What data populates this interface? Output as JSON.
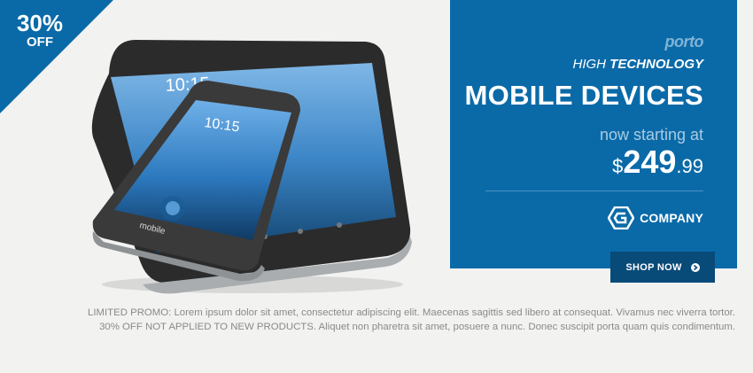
{
  "badge": {
    "percent": "30%",
    "off": "OFF"
  },
  "panel": {
    "brand": "porto",
    "subtitle_light": "HIGH",
    "subtitle_bold": "TECHNOLOGY",
    "headline": "MOBILE DEVICES",
    "starting_text": "now starting at",
    "price_currency": "$",
    "price_whole": "249",
    "price_decimal": ".99",
    "company": "COMPANY"
  },
  "device": {
    "tablet_clock": "10:15",
    "phone_clock": "10:15",
    "phone_brand": "mobile"
  },
  "cta": {
    "label": "SHOP NOW",
    "icon": "chevron-circle-right-icon"
  },
  "fine_print": {
    "line1": "LIMITED PROMO: Lorem ipsum dolor sit amet, consectetur adipiscing elit. Maecenas sagittis sed libero at consequat. Vivamus nec viverra tortor.",
    "line2_bold": "30% OFF NOT APPLIED TO NEW PRODUCTS.",
    "line2_rest": " Aliquet non pharetra sit amet, posuere a nunc. Donec suscipit porta quam quis condimentum."
  },
  "colors": {
    "accent": "#0a6aa8",
    "button": "#084a78",
    "background": "#f2f2f0"
  }
}
